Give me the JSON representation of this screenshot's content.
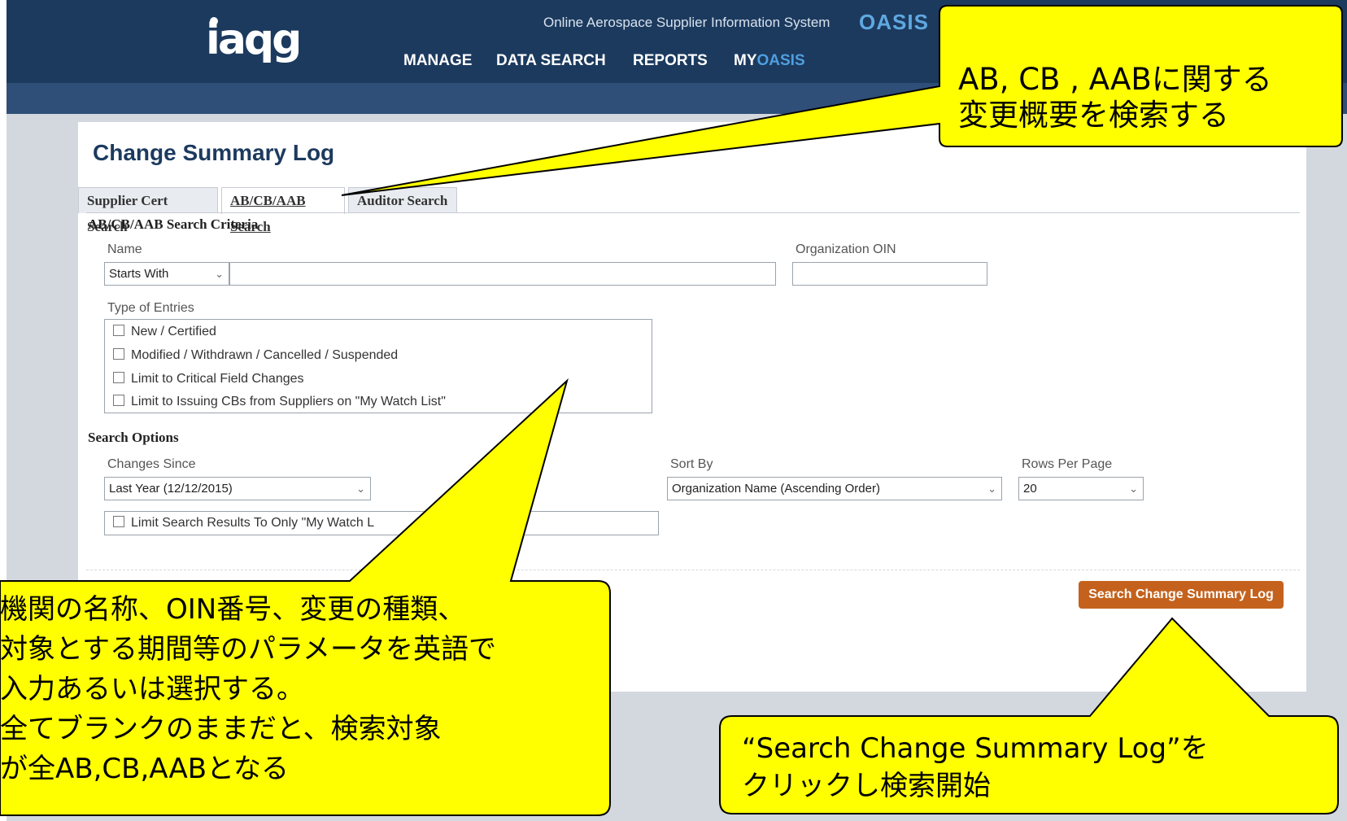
{
  "header": {
    "subtitle": "Online Aerospace Supplier Information System",
    "brand": "OASIS",
    "logo_text": "iaqg",
    "nav": [
      {
        "label": "MANAGE"
      },
      {
        "label": "DATA SEARCH"
      },
      {
        "label": "REPORTS"
      }
    ],
    "my_prefix": "MY",
    "my_suffix": "OASIS"
  },
  "page_title": "Change Summary Log",
  "tabs": [
    {
      "label": "Supplier Cert Search"
    },
    {
      "label": "AB/CB/AAB Search",
      "active": true
    },
    {
      "label": "Auditor Search"
    }
  ],
  "criteria": {
    "heading": "AB/CB/AAB Search Criteria",
    "name_label": "Name",
    "name_match": "Starts With",
    "name_value": "",
    "oin_label": "Organization OIN",
    "oin_value": "",
    "entries_label": "Type of Entries",
    "entries": [
      "New / Certified",
      "Modified / Withdrawn / Cancelled / Suspended",
      "Limit to Critical Field Changes",
      "Limit to Issuing CBs from Suppliers on \"My Watch List\""
    ]
  },
  "options": {
    "heading": "Search Options",
    "changes_since_label": "Changes Since",
    "changes_since_value": "Last Year (12/12/2015)",
    "sort_by_label": "Sort By",
    "sort_by_value": "Organization Name (Ascending Order)",
    "rows_label": "Rows Per Page",
    "rows_value": "20",
    "watch_limit": "Limit Search Results To Only \"My Watch L"
  },
  "search_button": "Search Change Summary Log",
  "callouts": {
    "top_right": [
      "AB, CB , AABに関する",
      "変更概要を検索する"
    ],
    "bottom_left": [
      "機関の名称、OIN番号、変更の種類、",
      "対象とする期間等のパラメータを英語で",
      "入力あるいは選択する。",
      "全てブランクのままだと、検索対象",
      "が全AB,CB,AABとなる"
    ],
    "bottom_right": [
      "“Search Change Summary Log”を",
      "クリックし検索開始"
    ]
  },
  "colors": {
    "nav_bg": "#1c3a5e",
    "accent_blue": "#4f9fe0",
    "button_orange": "#c4621d",
    "callout_yellow": "#ffff00"
  }
}
